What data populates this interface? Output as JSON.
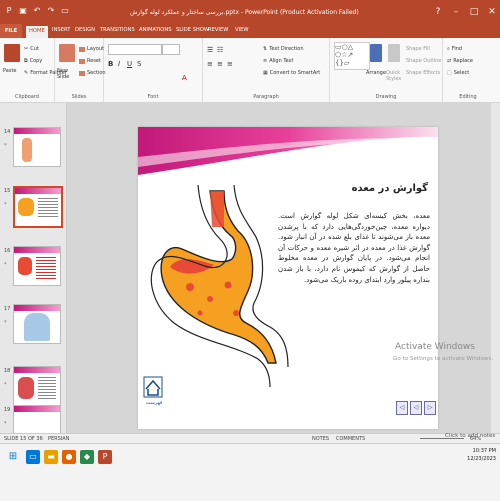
{
  "window": {
    "title": "بررسی ساختار و عملکرد لوله گوارش.pptx - PowerPoint (Product Activation Failed)",
    "minimize": "–",
    "maximize": "□",
    "close": "✕",
    "help": "?"
  },
  "ribbon_tabs": [
    "FILE",
    "HOME",
    "INSERT",
    "DESIGN",
    "TRANSITIONS",
    "ANIMATIONS",
    "SLIDE SHOW",
    "REVIEW",
    "VIEW"
  ],
  "active_tab": "HOME",
  "clipboard": {
    "paste": "Paste",
    "cut": "Cut",
    "copy": "Copy",
    "format_painter": "Format Painter",
    "group": "Clipboard"
  },
  "slides_group": {
    "new_slide": "New Slide",
    "layout": "Layout",
    "reset": "Reset",
    "section": "Section",
    "group": "Slides"
  },
  "font_group": {
    "group": "Font"
  },
  "paragraph_group": {
    "text_direction": "Text Direction",
    "align_text": "Align Text",
    "convert_smartart": "Convert to SmartArt",
    "group": "Paragraph"
  },
  "drawing_group": {
    "arrange": "Arrange",
    "quick_styles": "Quick Styles",
    "shape_fill": "Shape Fill",
    "shape_outline": "Shape Outline",
    "shape_effects": "Shape Effects",
    "group": "Drawing"
  },
  "editing_group": {
    "find": "Find",
    "replace": "Replace",
    "select": "Select",
    "group": "Editing"
  },
  "thumbnails": [
    {
      "num": "14",
      "star": "*"
    },
    {
      "num": "15",
      "star": "*"
    },
    {
      "num": "16",
      "star": "*"
    },
    {
      "num": "17",
      "star": "*"
    },
    {
      "num": "18",
      "star": "*"
    },
    {
      "num": "19",
      "star": "*"
    }
  ],
  "slide": {
    "title": "گوارش در معده",
    "body": "معده، بخش کیسه‌ای شکل لوله گوارش است. دیواره معده، چین‌خوردگی‌هایی دارد که با پرشدن معده باز می‌شوند تا غذای بلع شده در آن انبار شود. گوارش غذا در معده در اثر شیره معده و حرکات آن انجام می‌شود. در پایان گوارش در معده مخلوط حاصل از گوارش که کیموس نام دارد، با باز شدن بنداره پیلور وارد ابتدای روده باریک می‌شود.",
    "home_label": "فهرست"
  },
  "activation": {
    "line1": "Activate Windows",
    "line2": "Go to Settings to activate Windows."
  },
  "status": {
    "slide_of": "SLIDE 15 OF 36",
    "language": "PERSIAN",
    "notes": "NOTES",
    "comments": "COMMENTS",
    "zoom": "64%",
    "click_hint": "Click to add notes"
  },
  "tray": {
    "time": "10:37 PM",
    "date": "12/23/2023"
  },
  "colors": {
    "accent": "#b7472a",
    "magenta": "#c2187a",
    "stomach_fill": "#f6a021",
    "stomach_red": "#e94a35"
  }
}
